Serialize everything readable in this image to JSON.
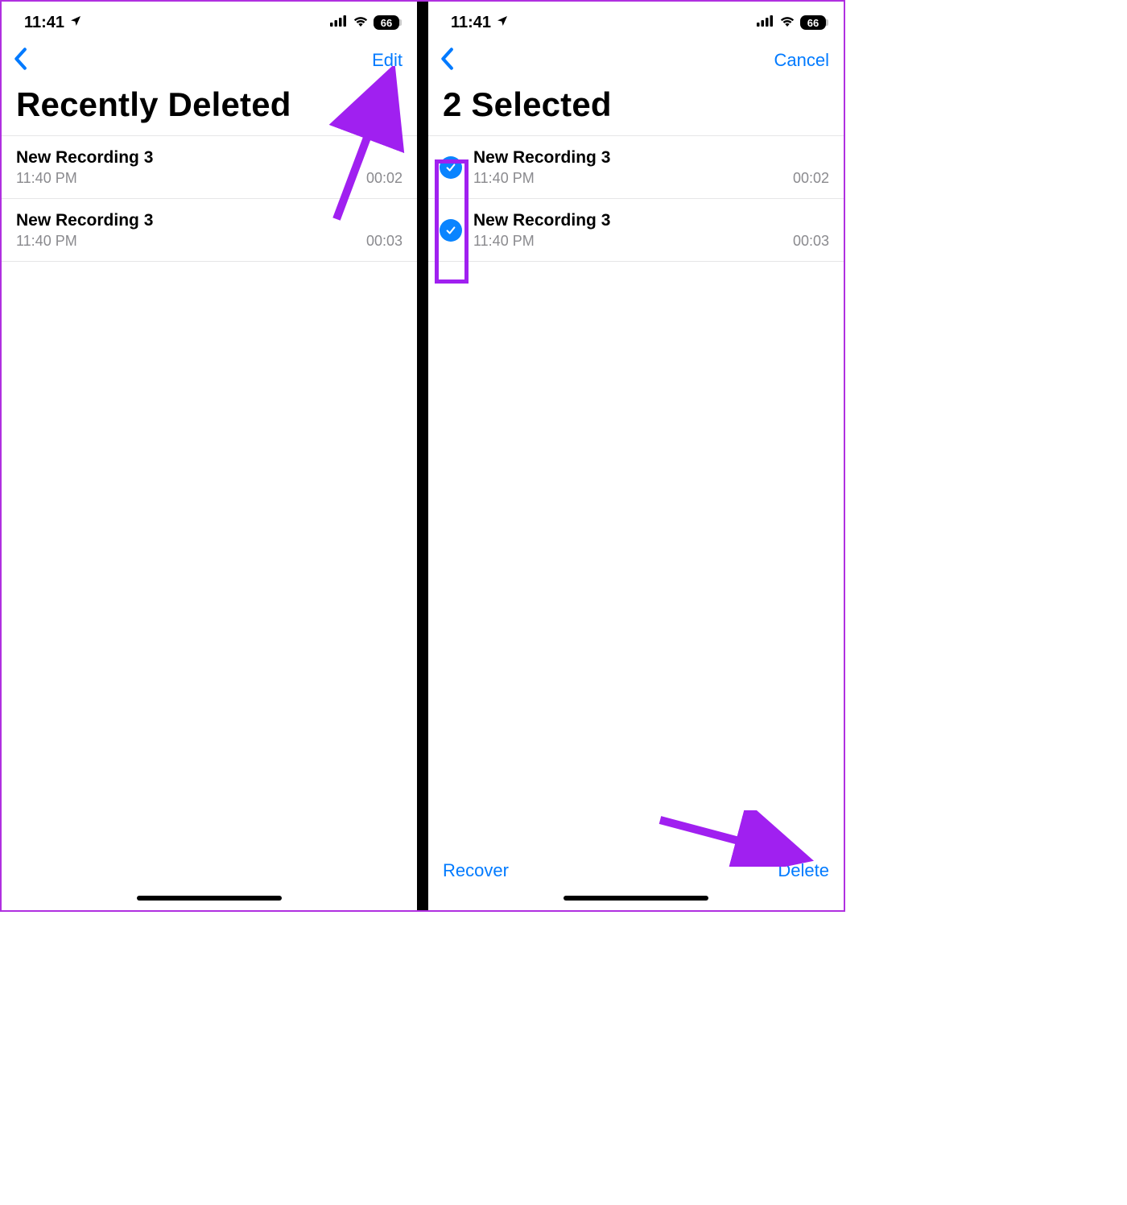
{
  "status": {
    "time": "11:41",
    "battery_pct": "66"
  },
  "colors": {
    "accent": "#007aff",
    "annotation": "#a020f0"
  },
  "left": {
    "nav_action": "Edit",
    "title": "Recently Deleted",
    "rows": [
      {
        "title": "New Recording 3",
        "time": "11:40 PM",
        "duration": "00:02"
      },
      {
        "title": "New Recording 3",
        "time": "11:40 PM",
        "duration": "00:03"
      }
    ]
  },
  "right": {
    "nav_action": "Cancel",
    "title": "2 Selected",
    "rows": [
      {
        "title": "New Recording 3",
        "time": "11:40 PM",
        "duration": "00:02",
        "selected": true
      },
      {
        "title": "New Recording 3",
        "time": "11:40 PM",
        "duration": "00:03",
        "selected": true
      }
    ],
    "toolbar": {
      "recover": "Recover",
      "delete": "Delete"
    }
  }
}
